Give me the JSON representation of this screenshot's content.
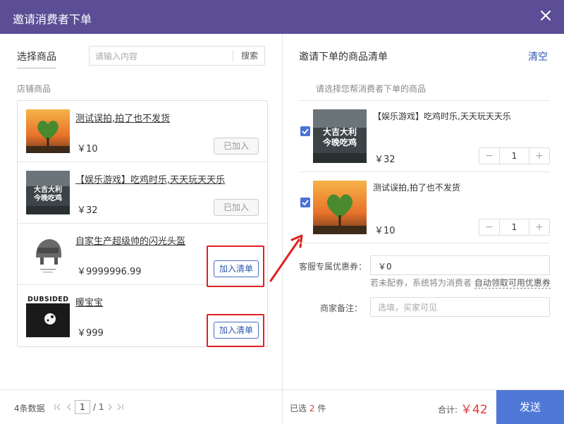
{
  "dialog": {
    "title": "邀请消费者下单",
    "close_icon": "close-icon"
  },
  "left": {
    "select_label": "选择商品",
    "search": {
      "placeholder": "请输入内容",
      "value": "",
      "button": "搜索"
    },
    "shop_label": "店铺商品",
    "products": [
      {
        "name": "测试误拍,拍了也不发货",
        "price": "￥10",
        "action": "已加入",
        "added": true,
        "thumb": "heart-tree-image"
      },
      {
        "name": "【娱乐游戏】吃鸡时乐,天天玩天天乐",
        "price": "￥32",
        "action": "已加入",
        "added": true,
        "thumb": "game-banner-image",
        "thumb_text": "大吉大利 今晚吃鸡"
      },
      {
        "name": "自家生产超级帅的闪光头盔",
        "price": "￥9999996.99",
        "action": "加入清单",
        "added": false,
        "thumb": "helmet-image"
      },
      {
        "name": "暖宝宝",
        "price": "￥999",
        "action": "加入清单",
        "added": false,
        "thumb": "album-cover-image",
        "thumb_text": "DUBSIDED"
      }
    ],
    "pager": {
      "count": "4条数据",
      "page": "1",
      "total": "/ 1"
    }
  },
  "right": {
    "title": "邀请下单的商品清单",
    "clear": "清空",
    "hint": "请选择您帮消费者下单的商品",
    "items": [
      {
        "name": "【娱乐游戏】吃鸡时乐,天天玩天天乐",
        "price": "￥32",
        "qty": "1",
        "checked": true,
        "thumb_text": "大吉大利 今晚吃鸡"
      },
      {
        "name": "测试误拍,拍了也不发货",
        "price": "￥10",
        "qty": "1",
        "checked": true
      }
    ],
    "coupon_label": "客服专属优惠券：",
    "coupon_value": "￥0",
    "coupon_note_prefix": "若未配券，系统将为消费者",
    "coupon_note_link": "自动领取可用优惠券",
    "remark_label": "商家备注：",
    "remark_placeholder": "选填，买家可见"
  },
  "footer": {
    "selected_prefix": "已选",
    "selected_count": "2",
    "selected_suffix": "件",
    "total_label": "合计:",
    "total_value": "￥42",
    "send": "发送"
  },
  "colors": {
    "header": "#5b4e96",
    "accent": "#4f77d6",
    "price_red": "#e03a3a",
    "highlight": "#e02020"
  }
}
